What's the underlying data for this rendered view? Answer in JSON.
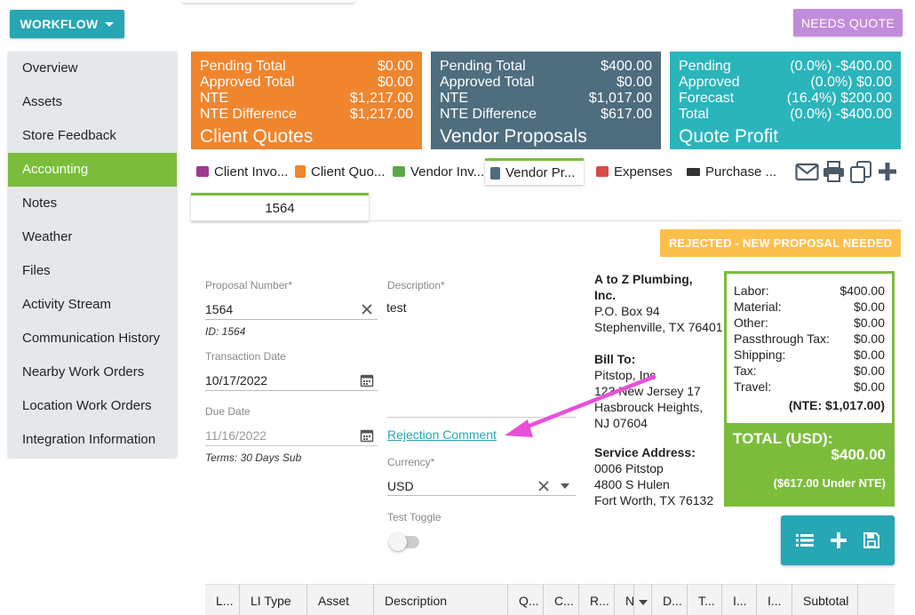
{
  "workflow": {
    "label": "WORKFLOW"
  },
  "status_button": {
    "label": "NEEDS QUOTE"
  },
  "sidebar": {
    "items": [
      {
        "label": "Overview"
      },
      {
        "label": "Assets"
      },
      {
        "label": "Store Feedback"
      },
      {
        "label": "Accounting",
        "active": true
      },
      {
        "label": "Notes"
      },
      {
        "label": "Weather"
      },
      {
        "label": "Files"
      },
      {
        "label": "Activity Stream"
      },
      {
        "label": "Communication History"
      },
      {
        "label": "Nearby Work Orders"
      },
      {
        "label": "Location Work Orders"
      },
      {
        "label": "Integration Information"
      }
    ]
  },
  "cards": {
    "client": {
      "rows": [
        {
          "label": "Pending Total",
          "value": "$0.00"
        },
        {
          "label": "Approved Total",
          "value": "$0.00"
        },
        {
          "label": "NTE",
          "value": "$1,217.00"
        },
        {
          "label": "NTE Difference",
          "value": "$1,217.00"
        }
      ],
      "title": "Client Quotes",
      "color": "#f0852d"
    },
    "vendor": {
      "rows": [
        {
          "label": "Pending Total",
          "value": "$400.00"
        },
        {
          "label": "Approved Total",
          "value": "$0.00"
        },
        {
          "label": "NTE",
          "value": "$1,017.00"
        },
        {
          "label": "NTE Difference",
          "value": "$617.00"
        }
      ],
      "title": "Vendor Proposals",
      "color": "#4e6d7e"
    },
    "profit": {
      "rows": [
        {
          "label": "Pending",
          "value": "(0.0%) -$400.00"
        },
        {
          "label": "Approved",
          "value": "(0.0%) $0.00"
        },
        {
          "label": "Forecast",
          "value": "(16.4%) $200.00"
        },
        {
          "label": "Total",
          "value": "(0.0%) -$400.00"
        }
      ],
      "title": "Quote Profit",
      "color": "#2ab5bb"
    }
  },
  "tabs": [
    {
      "label": "Client Invo...",
      "icon": "invoice-icon"
    },
    {
      "label": "Client Quo...",
      "icon": "quote-icon"
    },
    {
      "label": "Vendor Inv...",
      "icon": "money-icon"
    },
    {
      "label": "Vendor Pr...",
      "icon": "document-icon",
      "active": true
    },
    {
      "label": "Expenses",
      "icon": "receipt-icon"
    },
    {
      "label": "Purchase ...",
      "icon": "truck-icon"
    }
  ],
  "toolbar_icons": [
    "email-icon",
    "print-icon",
    "copy-icon",
    "add-icon"
  ],
  "proposal_tab": {
    "label": "1564"
  },
  "status_banner": {
    "label": "REJECTED - NEW PROPOSAL NEEDED"
  },
  "form": {
    "proposal_number": {
      "label": "Proposal Number*",
      "value": "1564",
      "hint": "ID: 1564"
    },
    "transaction_date": {
      "label": "Transaction Date",
      "value": "10/17/2022"
    },
    "due_date": {
      "label": "Due Date",
      "value": "11/16/2022",
      "hint": "Terms: 30 Days Sub"
    },
    "description": {
      "label": "Description*",
      "value": "test"
    },
    "rejection_link": "Rejection Comment",
    "currency": {
      "label": "Currency*",
      "value": "USD"
    },
    "toggle": {
      "label": "Test Toggle",
      "on": false
    }
  },
  "vendor": {
    "name_line1": "A to Z Plumbing,",
    "name_line2": "Inc.",
    "address1": "P.O. Box 94",
    "address2": "Stephenville, TX 76401",
    "bill_to_label": "Bill To:",
    "bill_to": [
      "Pitstop, Inc",
      "123 New Jersey 17",
      "Hasbrouck Heights,",
      "NJ 07604"
    ],
    "service_label": "Service Address:",
    "service": [
      "0006 Pitstop",
      "4800 S Hulen",
      "Fort Worth, TX 76132"
    ]
  },
  "summary": {
    "rows": [
      {
        "label": "Labor:",
        "value": "$400.00"
      },
      {
        "label": "Material:",
        "value": "$0.00"
      },
      {
        "label": "Other:",
        "value": "$0.00"
      },
      {
        "label": "Passthrough Tax:",
        "value": "$0.00"
      },
      {
        "label": "Shipping:",
        "value": "$0.00"
      },
      {
        "label": "Tax:",
        "value": "$0.00"
      },
      {
        "label": "Travel:",
        "value": "$0.00"
      }
    ],
    "nte": "(NTE: $1,017.00)",
    "total_label": "TOTAL (USD):",
    "total_value": "$400.00",
    "under_nte": "($617.00 Under NTE)"
  },
  "line_items": {
    "columns": [
      "L...",
      "LI Type",
      "Asset",
      "Description",
      "Q...",
      "C...",
      "R...",
      "N",
      "D...",
      "T...",
      "I...",
      "I...",
      "Subtotal"
    ]
  },
  "colors": {
    "accent": "#27a6b4",
    "active_green": "#7bbd3b",
    "annotation_arrow": "#e94fd9"
  }
}
